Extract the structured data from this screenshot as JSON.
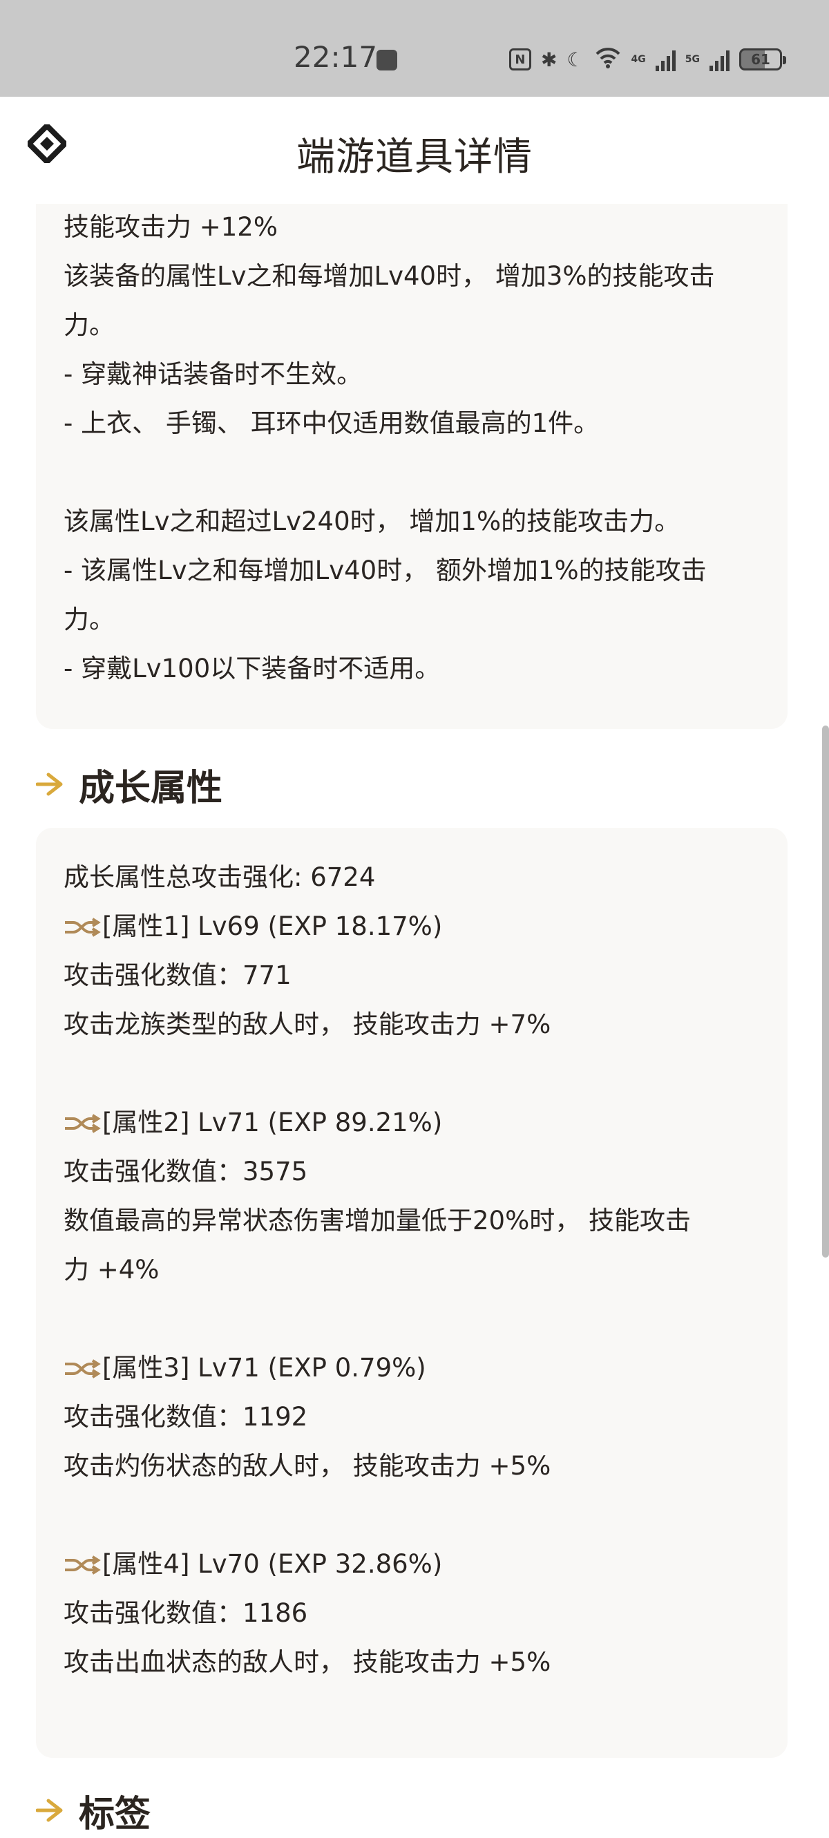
{
  "status_bar": {
    "time": "22:17",
    "battery": "61",
    "network_4g": "4G",
    "network_5g": "5G"
  },
  "header": {
    "title": "端游道具详情"
  },
  "skill_card": {
    "lines": [
      "技能攻击力 +12%",
      "该装备的属性Lv之和每增加Lv40时， 增加3%的技能攻击",
      "力。",
      "- 穿戴神话装备时不生效。",
      "- 上衣、 手镯、 耳环中仅适用数值最高的1件。",
      "",
      "该属性Lv之和超过Lv240时， 增加1%的技能攻击力。",
      "- 该属性Lv之和每增加Lv40时， 额外增加1%的技能攻击",
      "力。",
      "- 穿戴Lv100以下装备时不适用。"
    ]
  },
  "growth_section": {
    "title": "成长属性",
    "total": "成长属性总攻击强化: 6724",
    "attributes": [
      {
        "header": "[属性1] Lv69 (EXP 18.17%)",
        "value_line": "攻击强化数值：771",
        "effect_lines": [
          "攻击龙族类型的敌人时， 技能攻击力 +7%"
        ]
      },
      {
        "header": "[属性2] Lv71 (EXP 89.21%)",
        "value_line": "攻击强化数值：3575",
        "effect_lines": [
          "数值最高的异常状态伤害增加量低于20%时， 技能攻击",
          "力 +4%"
        ]
      },
      {
        "header": "[属性3] Lv71 (EXP 0.79%)",
        "value_line": "攻击强化数值：1192",
        "effect_lines": [
          "攻击灼伤状态的敌人时， 技能攻击力 +5%"
        ]
      },
      {
        "header": "[属性4] Lv70 (EXP 32.86%)",
        "value_line": "攻击强化数值：1186",
        "effect_lines": [
          "攻击出血状态的敌人时， 技能攻击力 +5%"
        ]
      }
    ]
  },
  "tags_section": {
    "title": "标签"
  },
  "colors": {
    "accent": "#d9a93c",
    "card_bg": "#f9f8f6",
    "text": "#2a2522"
  },
  "icons": {
    "logo": "diamond-logo-icon",
    "section": "arrow-right-icon",
    "attribute": "shuffle-icon"
  }
}
